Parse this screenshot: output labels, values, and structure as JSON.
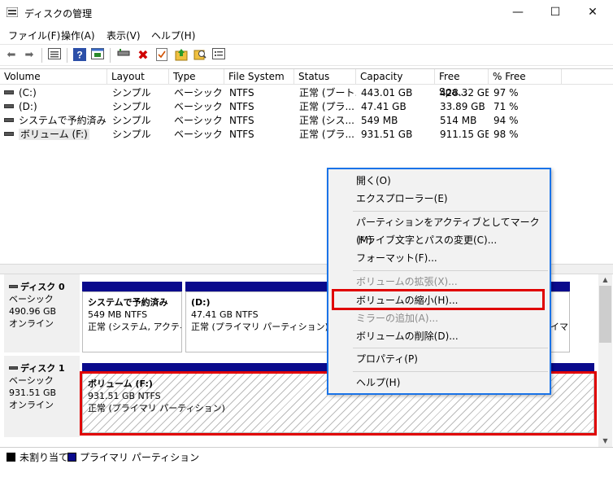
{
  "window": {
    "title": "ディスクの管理",
    "minimize": "—",
    "maximize": "☐",
    "close": "✕"
  },
  "menubar": {
    "items": [
      "ファイル(F)",
      "操作(A)",
      "表示(V)",
      "ヘルプ(H)"
    ]
  },
  "toolbar": {
    "icons": [
      "back-icon",
      "forward-icon",
      "list-view-icon",
      "help-icon",
      "properties-icon",
      "connect-icon",
      "delete-icon",
      "check-icon",
      "import-icon",
      "search-icon",
      "console-icon"
    ]
  },
  "volumes": {
    "columns": [
      "Volume",
      "Layout",
      "Type",
      "File System",
      "Status",
      "Capacity",
      "Free Spa...",
      "% Free"
    ],
    "rows": [
      [
        "(C:)",
        "シンプル",
        "ベーシック",
        "NTFS",
        "正常 (ブート...",
        "443.01 GB",
        "428.32 GB",
        "97 %"
      ],
      [
        "(D:)",
        "シンプル",
        "ベーシック",
        "NTFS",
        "正常 (プラ...",
        "47.41 GB",
        "33.89 GB",
        "71 %"
      ],
      [
        "システムで予約済み",
        "シンプル",
        "ベーシック",
        "NTFS",
        "正常 (シス...",
        "549 MB",
        "514 MB",
        "94 %"
      ],
      [
        "ボリューム (F:)",
        "シンプル",
        "ベーシック",
        "NTFS",
        "正常 (プラ...",
        "931.51 GB",
        "911.15 GB",
        "98 %"
      ]
    ]
  },
  "disks": [
    {
      "name": "ディスク 0",
      "type": "ベーシック",
      "size": "490.96 GB",
      "state": "オンライン",
      "partitions": [
        {
          "name": "システムで予約済み",
          "size": "549 MB NTFS",
          "status": "正常 (システム, アクティ"
        },
        {
          "name": "(D:)",
          "size": "47.41 GB NTFS",
          "status": "正常 (プライマリ パーティション)"
        },
        {
          "tail": "イマ"
        }
      ]
    },
    {
      "name": "ディスク 1",
      "type": "ベーシック",
      "size": "931.51 GB",
      "state": "オンライン",
      "partitions": [
        {
          "name": "ボリューム  (F:)",
          "size": "931.51 GB NTFS",
          "status": "正常 (プライマリ パーティション)"
        }
      ]
    }
  ],
  "legend": {
    "unallocated": "未割り当て",
    "primary": "プライマリ パーティション",
    "unallocated_color": "#000000",
    "primary_color": "#0a0a8c"
  },
  "context_menu": {
    "items": [
      {
        "label": "開く(O)",
        "enabled": true
      },
      {
        "label": "エクスプローラー(E)",
        "enabled": true
      },
      {
        "label": "パーティションをアクティブとしてマーク(M)",
        "enabled": true
      },
      {
        "label": "ドライブ文字とパスの変更(C)...",
        "enabled": true
      },
      {
        "label": "フォーマット(F)...",
        "enabled": true
      },
      {
        "label": "ボリュームの拡張(X)...",
        "enabled": false
      },
      {
        "label": "ボリュームの縮小(H)...",
        "enabled": true,
        "highlighted": true
      },
      {
        "label": "ミラーの追加(A)...",
        "enabled": false
      },
      {
        "label": "ボリュームの削除(D)...",
        "enabled": true
      },
      {
        "label": "プロパティ(P)",
        "enabled": true
      },
      {
        "label": "ヘルプ(H)",
        "enabled": true
      }
    ]
  },
  "colors": {
    "highlight_box": "#e00000",
    "menu_border": "#1a73e8",
    "partition_bar": "#0a0a8c"
  }
}
